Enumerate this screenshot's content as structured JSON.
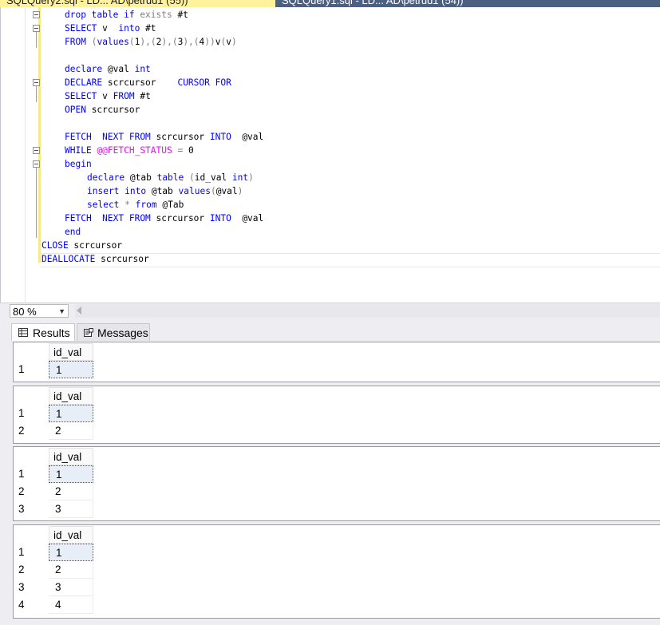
{
  "tabs": [
    {
      "label": "SQLQuery2.sql - LD... AD\\petrud1 (55))",
      "active": true
    },
    {
      "label": "SQLQuery1.sql - LD... AD\\petrud1 (54))",
      "active": false
    }
  ],
  "zoom": {
    "value": "80 %"
  },
  "results_tabs": [
    {
      "label": "Results",
      "icon": "grid-icon",
      "active": true
    },
    {
      "label": "Messages",
      "icon": "messages-icon",
      "active": false
    }
  ],
  "result_sets": [
    {
      "column": "id_val",
      "rows": [
        {
          "n": "1",
          "v": "1"
        }
      ]
    },
    {
      "column": "id_val",
      "rows": [
        {
          "n": "1",
          "v": "1"
        },
        {
          "n": "2",
          "v": "2"
        }
      ]
    },
    {
      "column": "id_val",
      "rows": [
        {
          "n": "1",
          "v": "1"
        },
        {
          "n": "2",
          "v": "2"
        },
        {
          "n": "3",
          "v": "3"
        }
      ]
    },
    {
      "column": "id_val",
      "rows": [
        {
          "n": "1",
          "v": "1"
        },
        {
          "n": "2",
          "v": "2"
        },
        {
          "n": "3",
          "v": "3"
        },
        {
          "n": "4",
          "v": "4"
        }
      ]
    }
  ],
  "colors": {
    "keyword": "#0000ff",
    "operator": "#808080",
    "system_function": "#ff00ff"
  }
}
